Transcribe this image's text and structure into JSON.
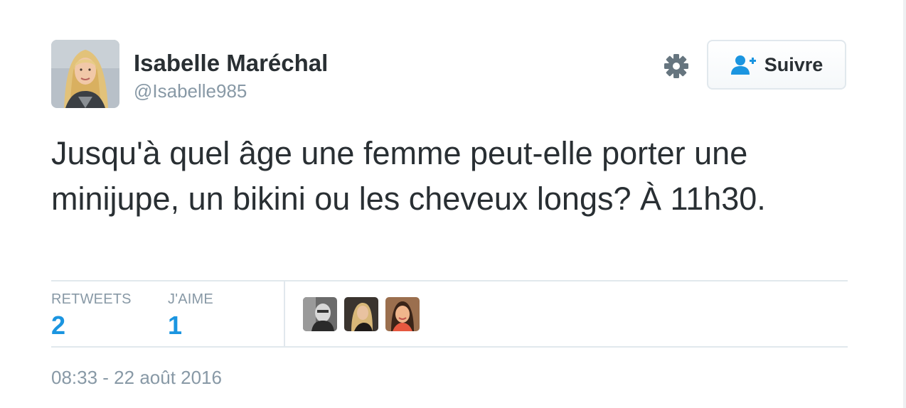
{
  "user": {
    "display_name": "Isabelle Maréchal",
    "screen_name": "@Isabelle985",
    "avatar_icon": "user-avatar-photo"
  },
  "actions": {
    "settings_icon": "gear-icon",
    "follow_icon": "add-user-icon",
    "follow_label": "Suivre"
  },
  "tweet": {
    "text": "Jusqu'à quel âge une femme peut-elle porter une minijupe, un bikini ou les cheveux longs? À 11h30."
  },
  "stats": {
    "retweets_label": "RETWEETS",
    "retweets_count": "2",
    "likes_label": "J'AIME",
    "likes_count": "1"
  },
  "likers": [
    "liker-avatar-1",
    "liker-avatar-2",
    "liker-avatar-3"
  ],
  "timestamp": "08:33 - 22 août 2016",
  "colors": {
    "text": "#292f33",
    "muted": "#8899a6",
    "accent": "#1b95e0",
    "border": "#e1e8ed"
  }
}
